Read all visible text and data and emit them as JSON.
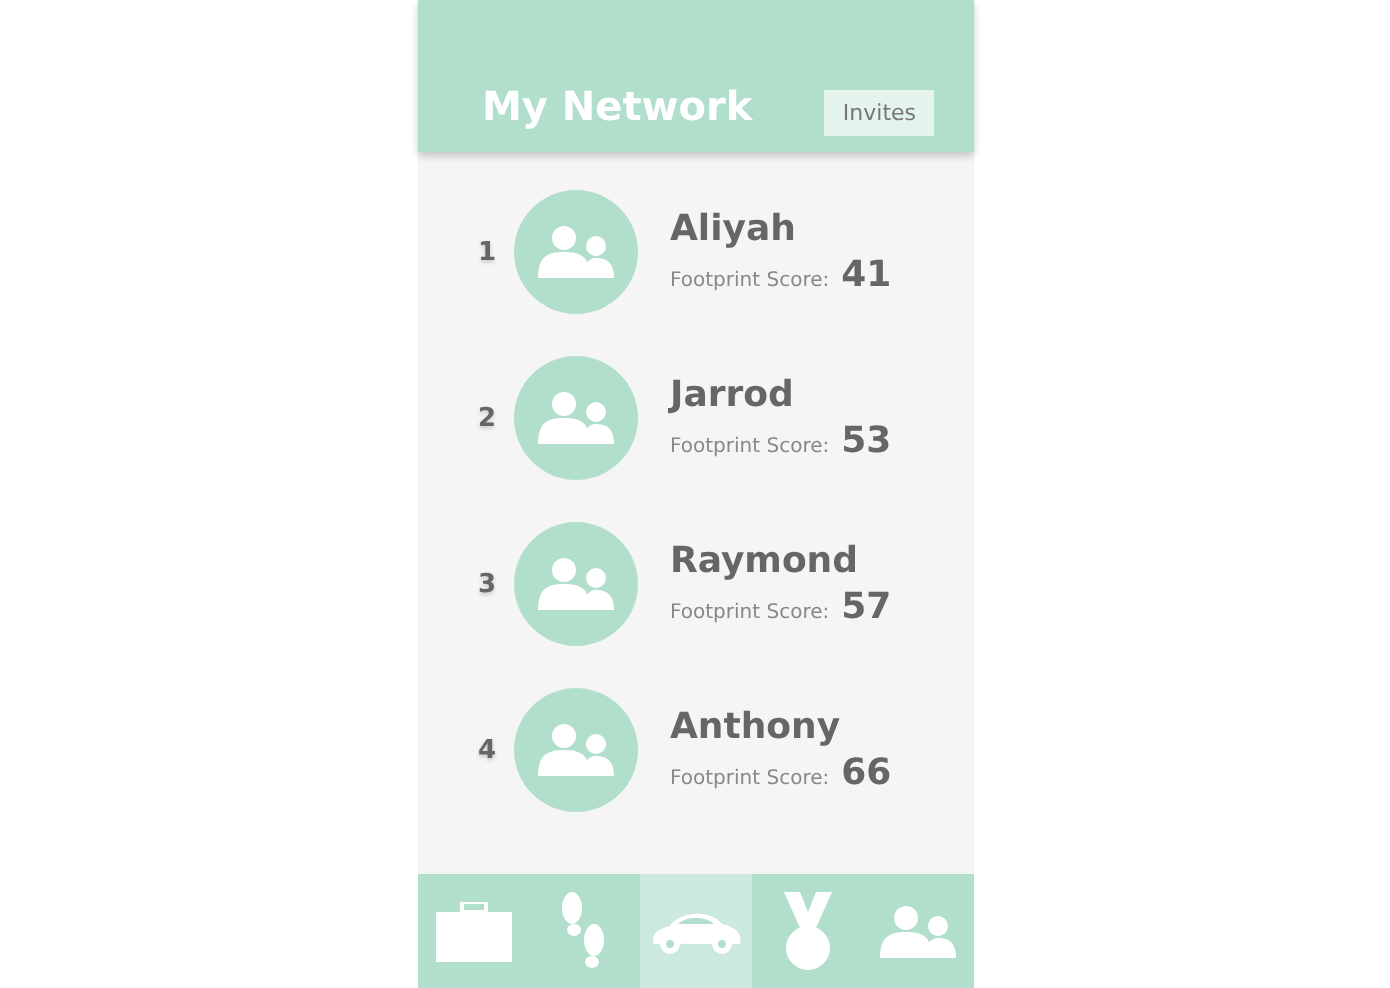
{
  "header": {
    "title": "My Network",
    "button": "Invites"
  },
  "people": [
    {
      "rank": "1",
      "name": "Aliyah",
      "score_label": "Footprint Score:",
      "score": "41"
    },
    {
      "rank": "2",
      "name": "Jarrod",
      "score_label": "Footprint Score:",
      "score": "53"
    },
    {
      "rank": "3",
      "name": "Raymond",
      "score_label": "Footprint Score:",
      "score": "57"
    },
    {
      "rank": "4",
      "name": "Anthony",
      "score_label": "Footprint Score:",
      "score": "66"
    }
  ],
  "nav": [
    {
      "kind": "briefcase",
      "selected": false
    },
    {
      "kind": "footprints",
      "selected": false
    },
    {
      "kind": "car",
      "selected": true
    },
    {
      "kind": "medal",
      "selected": false
    },
    {
      "kind": "people",
      "selected": false
    }
  ]
}
